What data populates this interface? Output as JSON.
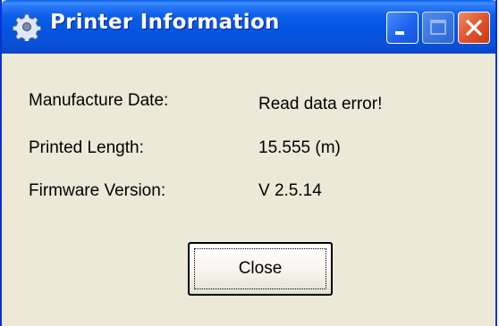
{
  "window": {
    "title": "Printer Information",
    "title_icon": "gear-icon",
    "controls": {
      "minimize_icon": "minimize-icon",
      "maximize_icon": "maximize-icon",
      "close_icon": "close-icon"
    }
  },
  "info": {
    "rows": [
      {
        "label": "Manufacture Date:",
        "value": "Read data error!"
      },
      {
        "label": "Printed Length:",
        "value": "15.555 (m)"
      },
      {
        "label": "Firmware Version:",
        "value": "V 2.5.14"
      }
    ]
  },
  "actions": {
    "close_label": "Close"
  },
  "colors": {
    "titlebar": "#0a5ee8",
    "window_bg": "#ece9d8",
    "close_button": "#e0502a"
  }
}
